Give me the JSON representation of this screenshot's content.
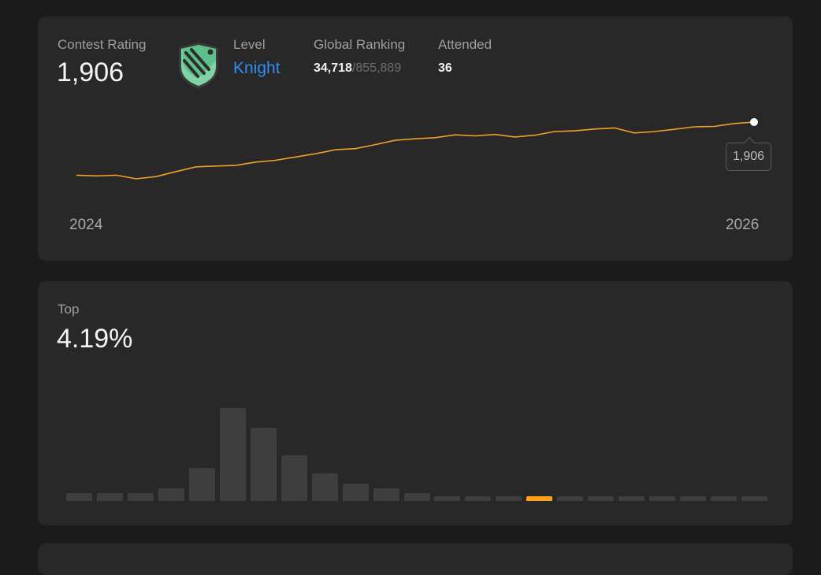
{
  "rating": {
    "label": "Contest Rating",
    "value": "1,906",
    "badge_icon": "knight-badge-icon",
    "level_label": "Level",
    "level_value": "Knight",
    "global_ranking_label": "Global Ranking",
    "global_rank": "34,718",
    "global_total": "/855,889",
    "attended_label": "Attended",
    "attended_value": "36",
    "tooltip": "1,906",
    "year_start": "2024",
    "year_end": "2026"
  },
  "distribution": {
    "top_label": "Top",
    "top_value": "4.19%"
  },
  "colors": {
    "line": "#f0a02c",
    "bar": "#3e3e3e",
    "highlight_bar": "#ffa116",
    "knight": "#2f8ff3"
  },
  "chart_data": [
    {
      "type": "line",
      "series": [
        {
          "values": [
            1520,
            1518,
            1520,
            1510,
            1516,
            1530,
            1543,
            1545,
            1547,
            1556,
            1561,
            1570,
            1579,
            1590,
            1593,
            1604,
            1616,
            1620,
            1623,
            1631,
            1628,
            1632,
            1625,
            1630,
            1640,
            1642,
            1647,
            1650,
            1636,
            1640,
            1646,
            1653,
            1654,
            1662,
            1666
          ]
        }
      ],
      "annotations": [
        "1,906"
      ]
    },
    {
      "type": "bar",
      "values": [
        3,
        3,
        3,
        5,
        13,
        37,
        29,
        18,
        11,
        7,
        5,
        3,
        2,
        2,
        2,
        2,
        2,
        2,
        2,
        2,
        2,
        2,
        2
      ],
      "highlight_index": 15
    }
  ]
}
